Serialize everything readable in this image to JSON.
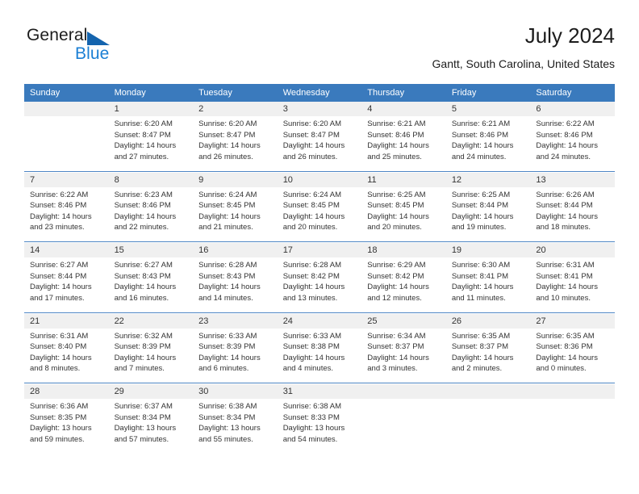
{
  "brand": {
    "word_one": "General",
    "word_two": "Blue",
    "triangle_color": "#1464ae",
    "blue_text_color": "#1b7fd4"
  },
  "header": {
    "title": "July 2024",
    "subtitle": "Gantt, South Carolina, United States"
  },
  "theme": {
    "header_row_bg": "#3a7abd",
    "header_row_text": "#ffffff",
    "daynum_band_bg": "#f0f0f0",
    "week_separator": "#4e86c4",
    "body_text": "#333333"
  },
  "weekday_headers": [
    "Sunday",
    "Monday",
    "Tuesday",
    "Wednesday",
    "Thursday",
    "Friday",
    "Saturday"
  ],
  "weeks": [
    {
      "days": [
        {
          "num": "",
          "sunrise": "",
          "sunset": "",
          "daylight_1": "",
          "daylight_2": ""
        },
        {
          "num": "1",
          "sunrise": "Sunrise: 6:20 AM",
          "sunset": "Sunset: 8:47 PM",
          "daylight_1": "Daylight: 14 hours",
          "daylight_2": "and 27 minutes."
        },
        {
          "num": "2",
          "sunrise": "Sunrise: 6:20 AM",
          "sunset": "Sunset: 8:47 PM",
          "daylight_1": "Daylight: 14 hours",
          "daylight_2": "and 26 minutes."
        },
        {
          "num": "3",
          "sunrise": "Sunrise: 6:20 AM",
          "sunset": "Sunset: 8:47 PM",
          "daylight_1": "Daylight: 14 hours",
          "daylight_2": "and 26 minutes."
        },
        {
          "num": "4",
          "sunrise": "Sunrise: 6:21 AM",
          "sunset": "Sunset: 8:46 PM",
          "daylight_1": "Daylight: 14 hours",
          "daylight_2": "and 25 minutes."
        },
        {
          "num": "5",
          "sunrise": "Sunrise: 6:21 AM",
          "sunset": "Sunset: 8:46 PM",
          "daylight_1": "Daylight: 14 hours",
          "daylight_2": "and 24 minutes."
        },
        {
          "num": "6",
          "sunrise": "Sunrise: 6:22 AM",
          "sunset": "Sunset: 8:46 PM",
          "daylight_1": "Daylight: 14 hours",
          "daylight_2": "and 24 minutes."
        }
      ]
    },
    {
      "days": [
        {
          "num": "7",
          "sunrise": "Sunrise: 6:22 AM",
          "sunset": "Sunset: 8:46 PM",
          "daylight_1": "Daylight: 14 hours",
          "daylight_2": "and 23 minutes."
        },
        {
          "num": "8",
          "sunrise": "Sunrise: 6:23 AM",
          "sunset": "Sunset: 8:46 PM",
          "daylight_1": "Daylight: 14 hours",
          "daylight_2": "and 22 minutes."
        },
        {
          "num": "9",
          "sunrise": "Sunrise: 6:24 AM",
          "sunset": "Sunset: 8:45 PM",
          "daylight_1": "Daylight: 14 hours",
          "daylight_2": "and 21 minutes."
        },
        {
          "num": "10",
          "sunrise": "Sunrise: 6:24 AM",
          "sunset": "Sunset: 8:45 PM",
          "daylight_1": "Daylight: 14 hours",
          "daylight_2": "and 20 minutes."
        },
        {
          "num": "11",
          "sunrise": "Sunrise: 6:25 AM",
          "sunset": "Sunset: 8:45 PM",
          "daylight_1": "Daylight: 14 hours",
          "daylight_2": "and 20 minutes."
        },
        {
          "num": "12",
          "sunrise": "Sunrise: 6:25 AM",
          "sunset": "Sunset: 8:44 PM",
          "daylight_1": "Daylight: 14 hours",
          "daylight_2": "and 19 minutes."
        },
        {
          "num": "13",
          "sunrise": "Sunrise: 6:26 AM",
          "sunset": "Sunset: 8:44 PM",
          "daylight_1": "Daylight: 14 hours",
          "daylight_2": "and 18 minutes."
        }
      ]
    },
    {
      "days": [
        {
          "num": "14",
          "sunrise": "Sunrise: 6:27 AM",
          "sunset": "Sunset: 8:44 PM",
          "daylight_1": "Daylight: 14 hours",
          "daylight_2": "and 17 minutes."
        },
        {
          "num": "15",
          "sunrise": "Sunrise: 6:27 AM",
          "sunset": "Sunset: 8:43 PM",
          "daylight_1": "Daylight: 14 hours",
          "daylight_2": "and 16 minutes."
        },
        {
          "num": "16",
          "sunrise": "Sunrise: 6:28 AM",
          "sunset": "Sunset: 8:43 PM",
          "daylight_1": "Daylight: 14 hours",
          "daylight_2": "and 14 minutes."
        },
        {
          "num": "17",
          "sunrise": "Sunrise: 6:28 AM",
          "sunset": "Sunset: 8:42 PM",
          "daylight_1": "Daylight: 14 hours",
          "daylight_2": "and 13 minutes."
        },
        {
          "num": "18",
          "sunrise": "Sunrise: 6:29 AM",
          "sunset": "Sunset: 8:42 PM",
          "daylight_1": "Daylight: 14 hours",
          "daylight_2": "and 12 minutes."
        },
        {
          "num": "19",
          "sunrise": "Sunrise: 6:30 AM",
          "sunset": "Sunset: 8:41 PM",
          "daylight_1": "Daylight: 14 hours",
          "daylight_2": "and 11 minutes."
        },
        {
          "num": "20",
          "sunrise": "Sunrise: 6:31 AM",
          "sunset": "Sunset: 8:41 PM",
          "daylight_1": "Daylight: 14 hours",
          "daylight_2": "and 10 minutes."
        }
      ]
    },
    {
      "days": [
        {
          "num": "21",
          "sunrise": "Sunrise: 6:31 AM",
          "sunset": "Sunset: 8:40 PM",
          "daylight_1": "Daylight: 14 hours",
          "daylight_2": "and 8 minutes."
        },
        {
          "num": "22",
          "sunrise": "Sunrise: 6:32 AM",
          "sunset": "Sunset: 8:39 PM",
          "daylight_1": "Daylight: 14 hours",
          "daylight_2": "and 7 minutes."
        },
        {
          "num": "23",
          "sunrise": "Sunrise: 6:33 AM",
          "sunset": "Sunset: 8:39 PM",
          "daylight_1": "Daylight: 14 hours",
          "daylight_2": "and 6 minutes."
        },
        {
          "num": "24",
          "sunrise": "Sunrise: 6:33 AM",
          "sunset": "Sunset: 8:38 PM",
          "daylight_1": "Daylight: 14 hours",
          "daylight_2": "and 4 minutes."
        },
        {
          "num": "25",
          "sunrise": "Sunrise: 6:34 AM",
          "sunset": "Sunset: 8:37 PM",
          "daylight_1": "Daylight: 14 hours",
          "daylight_2": "and 3 minutes."
        },
        {
          "num": "26",
          "sunrise": "Sunrise: 6:35 AM",
          "sunset": "Sunset: 8:37 PM",
          "daylight_1": "Daylight: 14 hours",
          "daylight_2": "and 2 minutes."
        },
        {
          "num": "27",
          "sunrise": "Sunrise: 6:35 AM",
          "sunset": "Sunset: 8:36 PM",
          "daylight_1": "Daylight: 14 hours",
          "daylight_2": "and 0 minutes."
        }
      ]
    },
    {
      "days": [
        {
          "num": "28",
          "sunrise": "Sunrise: 6:36 AM",
          "sunset": "Sunset: 8:35 PM",
          "daylight_1": "Daylight: 13 hours",
          "daylight_2": "and 59 minutes."
        },
        {
          "num": "29",
          "sunrise": "Sunrise: 6:37 AM",
          "sunset": "Sunset: 8:34 PM",
          "daylight_1": "Daylight: 13 hours",
          "daylight_2": "and 57 minutes."
        },
        {
          "num": "30",
          "sunrise": "Sunrise: 6:38 AM",
          "sunset": "Sunset: 8:34 PM",
          "daylight_1": "Daylight: 13 hours",
          "daylight_2": "and 55 minutes."
        },
        {
          "num": "31",
          "sunrise": "Sunrise: 6:38 AM",
          "sunset": "Sunset: 8:33 PM",
          "daylight_1": "Daylight: 13 hours",
          "daylight_2": "and 54 minutes."
        },
        {
          "num": "",
          "sunrise": "",
          "sunset": "",
          "daylight_1": "",
          "daylight_2": ""
        },
        {
          "num": "",
          "sunrise": "",
          "sunset": "",
          "daylight_1": "",
          "daylight_2": ""
        },
        {
          "num": "",
          "sunrise": "",
          "sunset": "",
          "daylight_1": "",
          "daylight_2": ""
        }
      ]
    }
  ]
}
